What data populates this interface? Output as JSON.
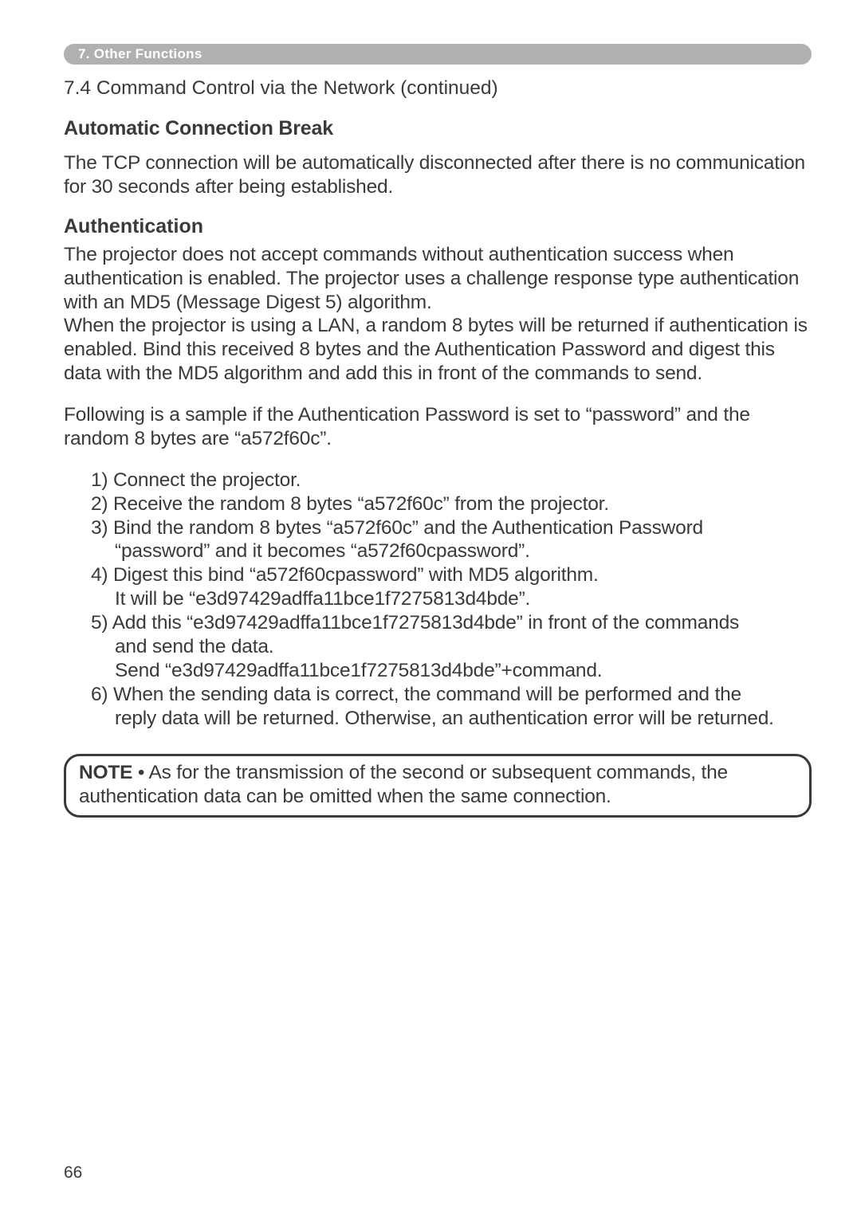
{
  "section_tab": "7. Other Functions",
  "cont_title": "7.4 Command Control via the Network (continued)",
  "heading_acb": "Automatic Connection Break",
  "acb_text": "The TCP connection will be automatically disconnected after there is no communication for 30 seconds after being established.",
  "heading_auth": "Authentication",
  "auth_para1": "The projector does not accept commands without authentication success when authentication is enabled. The projector uses a challenge response type authentication with an MD5 (Message Digest 5) algorithm.",
  "auth_para2": "When the projector is using a LAN, a random 8 bytes will be returned if authentication is enabled. Bind this received 8 bytes and the Authentication Password and digest this data with the MD5 algorithm and add this in front of the commands to send.",
  "auth_sample_intro": "Following is a sample if the Authentication Password is set to “password” and the random 8 bytes are “a572f60c”.",
  "steps": {
    "s1": "1) Connect the projector.",
    "s2": "2) Receive the random 8 bytes “a572f60c” from the projector.",
    "s3a": "3) Bind the random 8 bytes “a572f60c” and the Authentication Password",
    "s3b": "“password” and it becomes “a572f60cpassword”.",
    "s4a": "4) Digest this bind “a572f60cpassword” with MD5 algorithm.",
    "s4b": "It will be “e3d97429adffa11bce1f7275813d4bde”.",
    "s5a": "5) Add this “e3d97429adffa11bce1f7275813d4bde” in front of the commands",
    "s5b": "and send the data.",
    "s5c": "Send “e3d97429adffa11bce1f7275813d4bde”+command.",
    "s6a": "6) When the sending data is correct, the command will be performed and the",
    "s6b": "reply data will be returned. Otherwise, an authentication error will be returned."
  },
  "note_label": "NOTE",
  "note_text": " • As for the transmission of the second or subsequent commands, the authentication data can be omitted when the same connection.",
  "page_number": "66"
}
